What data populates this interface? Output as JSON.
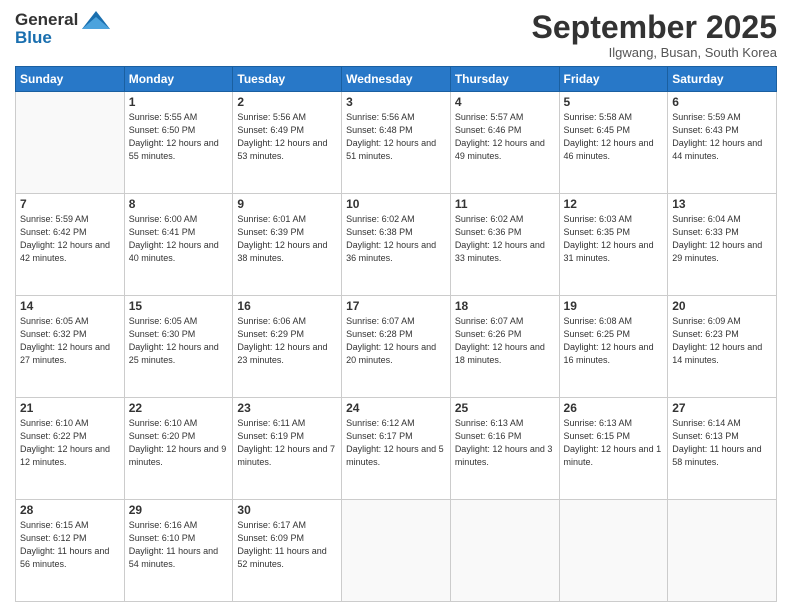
{
  "logo": {
    "line1": "General",
    "line2": "Blue"
  },
  "title": "September 2025",
  "location": "Ilgwang, Busan, South Korea",
  "days_header": [
    "Sunday",
    "Monday",
    "Tuesday",
    "Wednesday",
    "Thursday",
    "Friday",
    "Saturday"
  ],
  "weeks": [
    [
      {
        "day": "",
        "sunrise": "",
        "sunset": "",
        "daylight": ""
      },
      {
        "day": "1",
        "sunrise": "Sunrise: 5:55 AM",
        "sunset": "Sunset: 6:50 PM",
        "daylight": "Daylight: 12 hours and 55 minutes."
      },
      {
        "day": "2",
        "sunrise": "Sunrise: 5:56 AM",
        "sunset": "Sunset: 6:49 PM",
        "daylight": "Daylight: 12 hours and 53 minutes."
      },
      {
        "day": "3",
        "sunrise": "Sunrise: 5:56 AM",
        "sunset": "Sunset: 6:48 PM",
        "daylight": "Daylight: 12 hours and 51 minutes."
      },
      {
        "day": "4",
        "sunrise": "Sunrise: 5:57 AM",
        "sunset": "Sunset: 6:46 PM",
        "daylight": "Daylight: 12 hours and 49 minutes."
      },
      {
        "day": "5",
        "sunrise": "Sunrise: 5:58 AM",
        "sunset": "Sunset: 6:45 PM",
        "daylight": "Daylight: 12 hours and 46 minutes."
      },
      {
        "day": "6",
        "sunrise": "Sunrise: 5:59 AM",
        "sunset": "Sunset: 6:43 PM",
        "daylight": "Daylight: 12 hours and 44 minutes."
      }
    ],
    [
      {
        "day": "7",
        "sunrise": "Sunrise: 5:59 AM",
        "sunset": "Sunset: 6:42 PM",
        "daylight": "Daylight: 12 hours and 42 minutes."
      },
      {
        "day": "8",
        "sunrise": "Sunrise: 6:00 AM",
        "sunset": "Sunset: 6:41 PM",
        "daylight": "Daylight: 12 hours and 40 minutes."
      },
      {
        "day": "9",
        "sunrise": "Sunrise: 6:01 AM",
        "sunset": "Sunset: 6:39 PM",
        "daylight": "Daylight: 12 hours and 38 minutes."
      },
      {
        "day": "10",
        "sunrise": "Sunrise: 6:02 AM",
        "sunset": "Sunset: 6:38 PM",
        "daylight": "Daylight: 12 hours and 36 minutes."
      },
      {
        "day": "11",
        "sunrise": "Sunrise: 6:02 AM",
        "sunset": "Sunset: 6:36 PM",
        "daylight": "Daylight: 12 hours and 33 minutes."
      },
      {
        "day": "12",
        "sunrise": "Sunrise: 6:03 AM",
        "sunset": "Sunset: 6:35 PM",
        "daylight": "Daylight: 12 hours and 31 minutes."
      },
      {
        "day": "13",
        "sunrise": "Sunrise: 6:04 AM",
        "sunset": "Sunset: 6:33 PM",
        "daylight": "Daylight: 12 hours and 29 minutes."
      }
    ],
    [
      {
        "day": "14",
        "sunrise": "Sunrise: 6:05 AM",
        "sunset": "Sunset: 6:32 PM",
        "daylight": "Daylight: 12 hours and 27 minutes."
      },
      {
        "day": "15",
        "sunrise": "Sunrise: 6:05 AM",
        "sunset": "Sunset: 6:30 PM",
        "daylight": "Daylight: 12 hours and 25 minutes."
      },
      {
        "day": "16",
        "sunrise": "Sunrise: 6:06 AM",
        "sunset": "Sunset: 6:29 PM",
        "daylight": "Daylight: 12 hours and 23 minutes."
      },
      {
        "day": "17",
        "sunrise": "Sunrise: 6:07 AM",
        "sunset": "Sunset: 6:28 PM",
        "daylight": "Daylight: 12 hours and 20 minutes."
      },
      {
        "day": "18",
        "sunrise": "Sunrise: 6:07 AM",
        "sunset": "Sunset: 6:26 PM",
        "daylight": "Daylight: 12 hours and 18 minutes."
      },
      {
        "day": "19",
        "sunrise": "Sunrise: 6:08 AM",
        "sunset": "Sunset: 6:25 PM",
        "daylight": "Daylight: 12 hours and 16 minutes."
      },
      {
        "day": "20",
        "sunrise": "Sunrise: 6:09 AM",
        "sunset": "Sunset: 6:23 PM",
        "daylight": "Daylight: 12 hours and 14 minutes."
      }
    ],
    [
      {
        "day": "21",
        "sunrise": "Sunrise: 6:10 AM",
        "sunset": "Sunset: 6:22 PM",
        "daylight": "Daylight: 12 hours and 12 minutes."
      },
      {
        "day": "22",
        "sunrise": "Sunrise: 6:10 AM",
        "sunset": "Sunset: 6:20 PM",
        "daylight": "Daylight: 12 hours and 9 minutes."
      },
      {
        "day": "23",
        "sunrise": "Sunrise: 6:11 AM",
        "sunset": "Sunset: 6:19 PM",
        "daylight": "Daylight: 12 hours and 7 minutes."
      },
      {
        "day": "24",
        "sunrise": "Sunrise: 6:12 AM",
        "sunset": "Sunset: 6:17 PM",
        "daylight": "Daylight: 12 hours and 5 minutes."
      },
      {
        "day": "25",
        "sunrise": "Sunrise: 6:13 AM",
        "sunset": "Sunset: 6:16 PM",
        "daylight": "Daylight: 12 hours and 3 minutes."
      },
      {
        "day": "26",
        "sunrise": "Sunrise: 6:13 AM",
        "sunset": "Sunset: 6:15 PM",
        "daylight": "Daylight: 12 hours and 1 minute."
      },
      {
        "day": "27",
        "sunrise": "Sunrise: 6:14 AM",
        "sunset": "Sunset: 6:13 PM",
        "daylight": "Daylight: 11 hours and 58 minutes."
      }
    ],
    [
      {
        "day": "28",
        "sunrise": "Sunrise: 6:15 AM",
        "sunset": "Sunset: 6:12 PM",
        "daylight": "Daylight: 11 hours and 56 minutes."
      },
      {
        "day": "29",
        "sunrise": "Sunrise: 6:16 AM",
        "sunset": "Sunset: 6:10 PM",
        "daylight": "Daylight: 11 hours and 54 minutes."
      },
      {
        "day": "30",
        "sunrise": "Sunrise: 6:17 AM",
        "sunset": "Sunset: 6:09 PM",
        "daylight": "Daylight: 11 hours and 52 minutes."
      },
      {
        "day": "",
        "sunrise": "",
        "sunset": "",
        "daylight": ""
      },
      {
        "day": "",
        "sunrise": "",
        "sunset": "",
        "daylight": ""
      },
      {
        "day": "",
        "sunrise": "",
        "sunset": "",
        "daylight": ""
      },
      {
        "day": "",
        "sunrise": "",
        "sunset": "",
        "daylight": ""
      }
    ]
  ]
}
